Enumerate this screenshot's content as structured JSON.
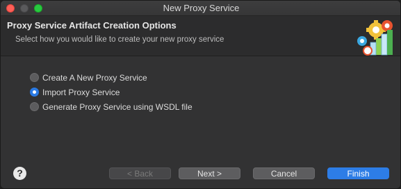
{
  "window": {
    "title": "New Proxy Service"
  },
  "banner": {
    "title": "Proxy Service Artifact Creation Options",
    "description": "Select how you would like to create your new proxy service"
  },
  "options": [
    {
      "label": "Create A New Proxy Service",
      "selected": false
    },
    {
      "label": "Import Proxy Service",
      "selected": true
    },
    {
      "label": "Generate Proxy Service using WSDL file",
      "selected": false
    }
  ],
  "footer": {
    "help_icon": "?",
    "back_label": "< Back",
    "next_label": "Next >",
    "cancel_label": "Cancel",
    "finish_label": "Finish"
  },
  "colors": {
    "accent": "#2d7de6",
    "close": "#ff5f57",
    "maximize": "#28c940"
  }
}
